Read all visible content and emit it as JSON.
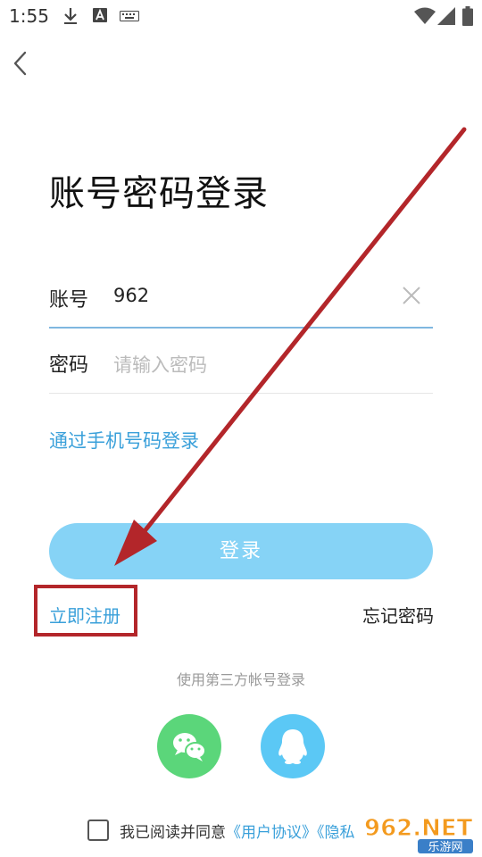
{
  "status_bar": {
    "time": "1:55"
  },
  "page": {
    "title": "账号密码登录"
  },
  "account": {
    "label": "账号",
    "value": "962"
  },
  "password": {
    "label": "密码",
    "placeholder": "请输入密码"
  },
  "links": {
    "phone_login": "通过手机号码登录",
    "register": "立即注册",
    "forgot": "忘记密码"
  },
  "login_button": {
    "label": "登录"
  },
  "third_party": {
    "label": "使用第三方帐号登录",
    "wechat_icon": "wechat-icon",
    "qq_icon": "qq-icon"
  },
  "agreement": {
    "prefix": "我已阅读并同意",
    "user_agreement": "《用户协议》",
    "privacy": "《隐私"
  },
  "watermark": {
    "brand": "962.NET",
    "sub": "乐游网"
  },
  "colors": {
    "accent": "#3aa0da",
    "button": "#86d3f6",
    "annotation": "#b3262a",
    "wechat": "#5bd67a",
    "qq": "#5bc8f5"
  }
}
